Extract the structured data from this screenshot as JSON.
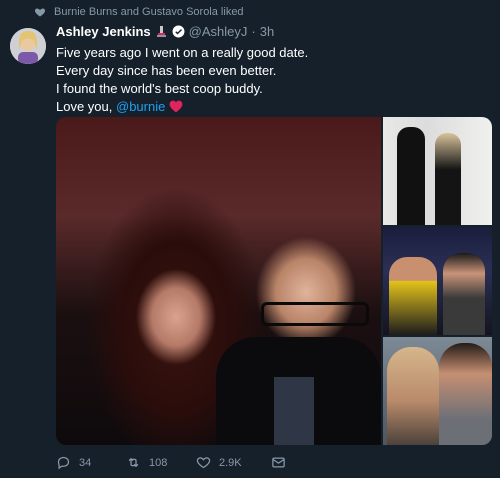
{
  "social_context": {
    "text": "Burnie Burns and Gustavo Sorola liked"
  },
  "tweet": {
    "author_name": "Ashley Jenkins",
    "handle": "@AshleyJ",
    "separator": "·",
    "time": "3h",
    "lines": [
      "Five years ago I went on a really good date.",
      "Every day since has been even better.",
      "I found the world's best coop buddy.",
      "Love you,"
    ],
    "mention": "@burnie"
  },
  "actions": {
    "replies": "34",
    "retweets": "108",
    "likes": "2.9K"
  },
  "colors": {
    "background": "#15202b",
    "muted": "#8899a6",
    "link": "#1da1f2",
    "heart": "#e0245e"
  },
  "icons": [
    "heart-icon",
    "reply-icon",
    "retweet-icon",
    "like-icon",
    "message-icon",
    "verified-icon",
    "trophy-icon"
  ]
}
